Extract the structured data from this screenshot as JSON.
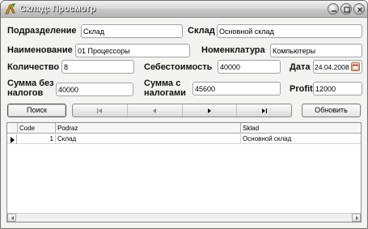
{
  "window": {
    "title": "Склад: Просмотр"
  },
  "form": {
    "subdivision": {
      "label": "Подразделение",
      "value": "Склад"
    },
    "warehouse": {
      "label": "Склад",
      "value": "Основной склад"
    },
    "name": {
      "label": "Наименование",
      "value": "01 Процессоры"
    },
    "nomenclature": {
      "label": "Номенклатура",
      "value": "Компьютеры"
    },
    "quantity": {
      "label": "Количество",
      "value": "8"
    },
    "cost": {
      "label": "Себестоимость",
      "value": "40000"
    },
    "date": {
      "label": "Дата",
      "value": "24.04.2008"
    },
    "sum_no_tax": {
      "label": "Сумма без налогов",
      "value": "40000"
    },
    "sum_with_tax": {
      "label": "Сумма с налогами",
      "value": "45600"
    },
    "profit": {
      "label": "Profit",
      "value": "12000"
    }
  },
  "toolbar": {
    "search_label": "Поиск",
    "refresh_label": "Обновить"
  },
  "navigator": {
    "buttons": [
      "first",
      "prior",
      "next",
      "last"
    ]
  },
  "grid": {
    "columns": [
      "Code",
      "Podraz",
      "Sklad"
    ],
    "rows": [
      {
        "code": "1",
        "podraz": "Склад",
        "sklad": "Основной склад",
        "current": true
      }
    ]
  },
  "colors": {
    "title_text": "#ffffff",
    "window_bg": "#f3f3f1",
    "accent": "#b56a3a"
  }
}
